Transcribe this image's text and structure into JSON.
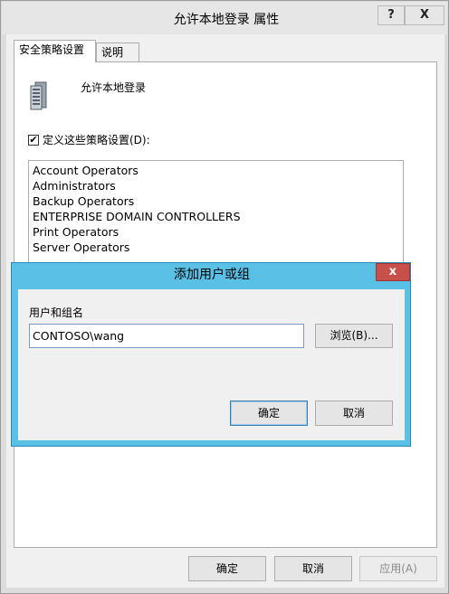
{
  "window": {
    "title": "允许本地登录 属性",
    "help_button": "?",
    "close_button": "X"
  },
  "tabs": [
    {
      "label": "安全策略设置",
      "active": true
    },
    {
      "label": "说明",
      "active": false
    }
  ],
  "policy": {
    "icon": "server-policy-icon",
    "name": "允许本地登录"
  },
  "define_checkbox": {
    "checked": true,
    "label": "定义这些策略设置(D):"
  },
  "members": [
    "Account Operators",
    "Administrators",
    "Backup Operators",
    "ENTERPRISE DOMAIN CONTROLLERS",
    "Print Operators",
    "Server Operators"
  ],
  "footer": {
    "ok": "确定",
    "cancel": "取消",
    "apply": "应用(A)"
  },
  "dialog": {
    "title": "添加用户或组",
    "close_button": "x",
    "field_label": "用户和组名",
    "field_value": "CONTOSO\\wang",
    "browse": "浏览(B)...",
    "ok": "确定",
    "cancel": "取消"
  },
  "colors": {
    "dialog_frame": "#5bc0e6",
    "dialog_close": "#c7504b"
  }
}
